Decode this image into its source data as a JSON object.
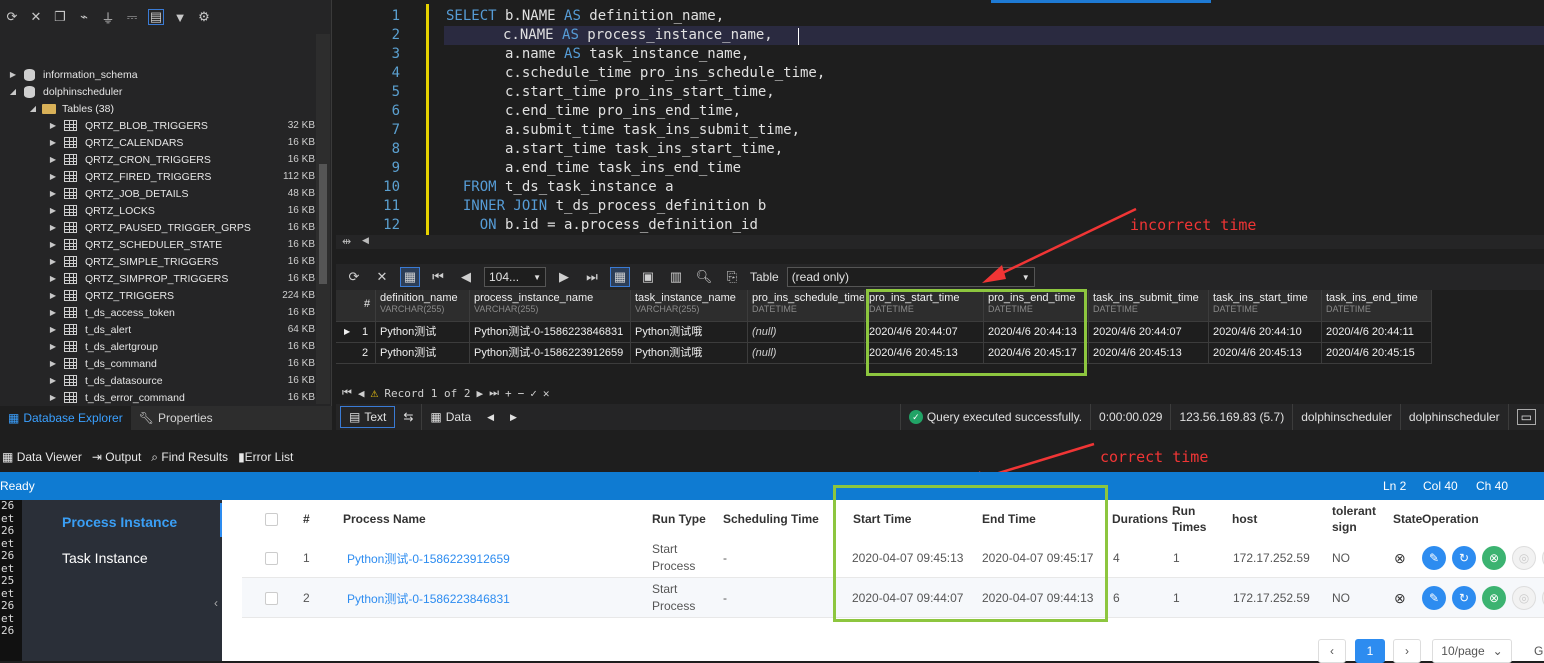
{
  "explorer": {
    "databases": [
      {
        "name": "information_schema"
      },
      {
        "name": "dolphinscheduler"
      }
    ],
    "tables_folder": "Tables (38)",
    "tables": [
      {
        "name": "QRTZ_BLOB_TRIGGERS",
        "size": "32 KB"
      },
      {
        "name": "QRTZ_CALENDARS",
        "size": "16 KB"
      },
      {
        "name": "QRTZ_CRON_TRIGGERS",
        "size": "16 KB"
      },
      {
        "name": "QRTZ_FIRED_TRIGGERS",
        "size": "112 KB"
      },
      {
        "name": "QRTZ_JOB_DETAILS",
        "size": "48 KB"
      },
      {
        "name": "QRTZ_LOCKS",
        "size": "16 KB"
      },
      {
        "name": "QRTZ_PAUSED_TRIGGER_GRPS",
        "size": "16 KB"
      },
      {
        "name": "QRTZ_SCHEDULER_STATE",
        "size": "16 KB"
      },
      {
        "name": "QRTZ_SIMPLE_TRIGGERS",
        "size": "16 KB"
      },
      {
        "name": "QRTZ_SIMPROP_TRIGGERS",
        "size": "16 KB"
      },
      {
        "name": "QRTZ_TRIGGERS",
        "size": "224 KB"
      },
      {
        "name": "t_ds_access_token",
        "size": "16 KB"
      },
      {
        "name": "t_ds_alert",
        "size": "64 KB"
      },
      {
        "name": "t_ds_alertgroup",
        "size": "16 KB"
      },
      {
        "name": "t_ds_command",
        "size": "16 KB"
      },
      {
        "name": "t_ds_datasource",
        "size": "16 KB"
      },
      {
        "name": "t_ds_error_command",
        "size": "16 KB"
      }
    ],
    "tabs": [
      "Database Explorer",
      "Properties"
    ]
  },
  "editor": {
    "line_numbers": [
      "1",
      "2",
      "3",
      "4",
      "5",
      "6",
      "7",
      "8",
      "9",
      "10",
      "11",
      "12"
    ],
    "lines": [
      {
        "kw": "SELECT",
        "text": " b.NAME ",
        "kw2": "AS",
        "rest": " definition_name,"
      },
      {
        "kw": "",
        "text": "       c.NAME ",
        "kw2": "AS",
        "rest": " process_instance_name,"
      },
      {
        "kw": "",
        "text": "       a.name ",
        "kw2": "AS",
        "rest": " task_instance_name,"
      },
      {
        "kw": "",
        "text": "       c.schedule_time pro_ins_schedule_time,",
        "kw2": "",
        "rest": ""
      },
      {
        "kw": "",
        "text": "       c.start_time pro_ins_start_time,",
        "kw2": "",
        "rest": ""
      },
      {
        "kw": "",
        "text": "       c.end_time pro_ins_end_time,",
        "kw2": "",
        "rest": ""
      },
      {
        "kw": "",
        "text": "       a.submit_time task_ins_submit_time,",
        "kw2": "",
        "rest": ""
      },
      {
        "kw": "",
        "text": "       a.start_time task_ins_start_time,",
        "kw2": "",
        "rest": ""
      },
      {
        "kw": "",
        "text": "       a.end_time task_ins_end_time",
        "kw2": "",
        "rest": ""
      },
      {
        "kw": "  FROM",
        "text": " t_ds_task_instance a",
        "kw2": "",
        "rest": ""
      },
      {
        "kw": "  INNER JOIN",
        "text": " t_ds_process_definition b",
        "kw2": "",
        "rest": ""
      },
      {
        "kw": "    ON",
        "text": " b.id = a.process_definition_id",
        "kw2": "",
        "rest": ""
      }
    ]
  },
  "grid_toolbar": {
    "limit": "104...",
    "table_label": "Table",
    "table_value": "(read only)"
  },
  "grid": {
    "hash": "#",
    "columns": [
      {
        "name": "definition_name",
        "type": "VARCHAR(255)"
      },
      {
        "name": "process_instance_name",
        "type": "VARCHAR(255)"
      },
      {
        "name": "task_instance_name",
        "type": "VARCHAR(255)"
      },
      {
        "name": "pro_ins_schedule_time",
        "type": "DATETIME"
      },
      {
        "name": "pro_ins_start_time",
        "type": "DATETIME"
      },
      {
        "name": "pro_ins_end_time",
        "type": "DATETIME"
      },
      {
        "name": "task_ins_submit_time",
        "type": "DATETIME"
      },
      {
        "name": "task_ins_start_time",
        "type": "DATETIME"
      },
      {
        "name": "task_ins_end_time",
        "type": "DATETIME"
      }
    ],
    "rows": [
      [
        "1",
        "Python测试",
        "Python测试-0-1586223846831",
        "Python测试哦",
        "(null)",
        "2020/4/6 20:44:07",
        "2020/4/6 20:44:13",
        "2020/4/6 20:44:07",
        "2020/4/6 20:44:10",
        "2020/4/6 20:44:11"
      ],
      [
        "2",
        "Python测试",
        "Python测试-0-1586223912659",
        "Python测试哦",
        "(null)",
        "2020/4/6 20:45:13",
        "2020/4/6 20:45:17",
        "2020/4/6 20:45:13",
        "2020/4/6 20:45:13",
        "2020/4/6 20:45:15"
      ]
    ],
    "record_text": "Record 1 of 2"
  },
  "annotations": {
    "incorrect": "incorrect time",
    "correct": "correct time"
  },
  "status": {
    "text_tab": "Text",
    "data_tab": "Data",
    "message": "Query executed successfully.",
    "duration": "0:00:00.029",
    "server": "123.56.169.83 (5.7)",
    "user": "dolphinscheduler",
    "database": "dolphinscheduler"
  },
  "bottom_tabs": [
    "Data Viewer",
    "Output",
    "Find Results",
    "Error List"
  ],
  "status_bar": {
    "ready": "Ready",
    "ln": "Ln 2",
    "col": "Col 40",
    "ch": "Ch 40"
  },
  "web": {
    "terminal_lines": [
      "26",
      "et",
      "26",
      "et",
      "26",
      "et",
      "25",
      "et",
      "26",
      "et",
      "26"
    ],
    "side": [
      "Process Instance",
      "Task Instance"
    ],
    "headers": {
      "hash": "#",
      "process_name": "Process Name",
      "run_type": "Run Type",
      "scheduling_time": "Scheduling Time",
      "start_time": "Start Time",
      "end_time": "End Time",
      "durations": "Durations",
      "run_times": "Run Times",
      "host": "host",
      "tolerant_sign": "tolerant sign",
      "state": "State",
      "operation": "Operation"
    },
    "rows": [
      {
        "idx": "1",
        "name": "Python测试-0-1586223912659",
        "run_type": "Start Process",
        "sched": "-",
        "start": "2020-04-07 09:45:13",
        "end": "2020-04-07 09:45:17",
        "dur": "4",
        "times": "1",
        "host": "172.17.252.59",
        "tol": "NO"
      },
      {
        "idx": "2",
        "name": "Python测试-0-1586223846831",
        "run_type": "Start Process",
        "sched": "-",
        "start": "2020-04-07 09:44:07",
        "end": "2020-04-07 09:44:13",
        "dur": "6",
        "times": "1",
        "host": "172.17.252.59",
        "tol": "NO"
      }
    ],
    "pagination": {
      "current": "1",
      "per_page": "10/page",
      "goto": "G"
    }
  },
  "colors": {
    "accent": "#0f7bd2",
    "highlight_box": "#8dc63f",
    "annotation": "#f03535",
    "link": "#2d8cf0"
  }
}
